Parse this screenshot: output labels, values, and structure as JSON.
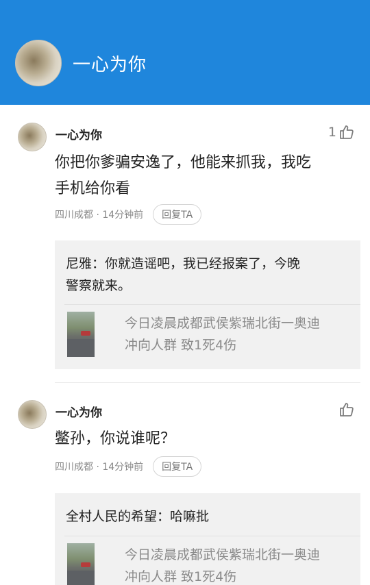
{
  "header": {
    "title": "一心为你"
  },
  "comments": [
    {
      "username": "一心为你",
      "like_count": "1",
      "text_lines": [
        "你把你爹骗安逸了，他能来抓我，我吃",
        "手机给你看"
      ],
      "location_time": "四川成都 · 14分钟前",
      "reply_label": "回复TA",
      "quote": {
        "text_lines": [
          "尼雅：你就造谣吧，我已经报案了，今晚",
          "警察就来。"
        ],
        "link_lines": [
          "今日凌晨成都武侯紫瑞北街一奥迪",
          "冲向人群 致1死4伤"
        ]
      }
    },
    {
      "username": "一心为你",
      "like_count": "",
      "text_lines": [
        "鳖孙，你说谁呢？"
      ],
      "location_time": "四川成都 · 14分钟前",
      "reply_label": "回复TA",
      "quote": {
        "text_lines": [
          "全村人民的希望：哈嘛批"
        ],
        "link_lines": [
          "今日凌晨成都武侯紫瑞北街一奥迪",
          "冲向人群 致1死4伤"
        ]
      }
    }
  ],
  "icons": {
    "like": "thumbs-up-icon"
  },
  "colors": {
    "header_bg": "#1f86dc",
    "quote_bg": "#f1f1f1"
  }
}
